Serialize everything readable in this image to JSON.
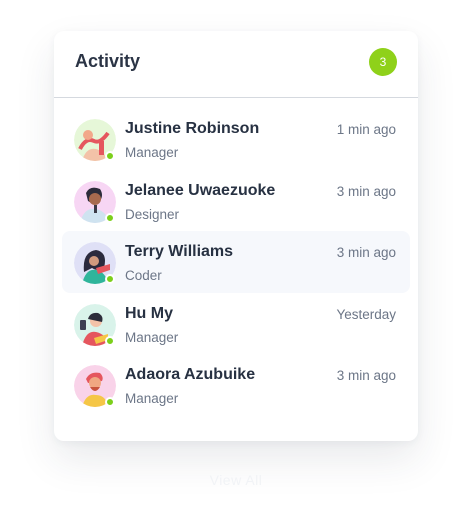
{
  "panel": {
    "title": "Activity",
    "count": "3"
  },
  "colors": {
    "badge": "#8fd11a",
    "online": "#7ccf1b",
    "active_row": "#f6f8fc"
  },
  "items": [
    {
      "name": "Justine Robinson",
      "role": "Manager",
      "time": "1 min ago",
      "avatar_icon": "person-avatar-icon",
      "online": true
    },
    {
      "name": "Jelanee Uwaezuoke",
      "role": "Designer",
      "time": "3 min ago",
      "avatar_icon": "person-avatar-icon",
      "online": true
    },
    {
      "name": "Terry Williams",
      "role": "Coder",
      "time": "3 min ago",
      "avatar_icon": "person-avatar-icon",
      "online": true
    },
    {
      "name": "Hu My",
      "role": "Manager",
      "time": "Yesterday",
      "avatar_icon": "person-avatar-icon",
      "online": true
    },
    {
      "name": "Adaora Azubuike",
      "role": "Manager",
      "time": "3 min ago",
      "avatar_icon": "person-avatar-icon",
      "online": true
    }
  ],
  "footer": {
    "view_all": "View All"
  }
}
